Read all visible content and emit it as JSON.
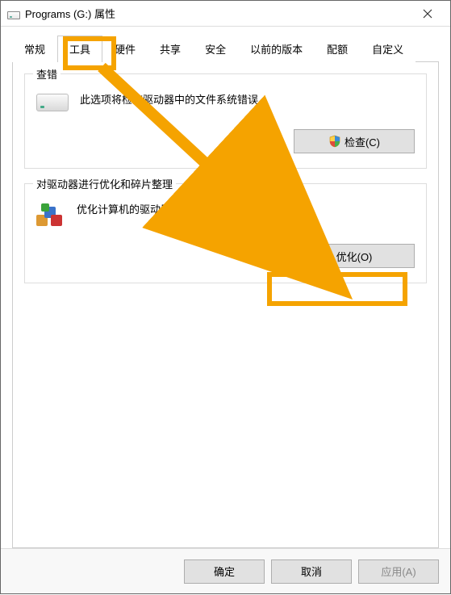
{
  "window": {
    "title": "Programs (G:) 属性"
  },
  "tabs": {
    "items": [
      {
        "label": "常规"
      },
      {
        "label": "工具"
      },
      {
        "label": "硬件"
      },
      {
        "label": "共享"
      },
      {
        "label": "安全"
      },
      {
        "label": "以前的版本"
      },
      {
        "label": "配额"
      },
      {
        "label": "自定义"
      }
    ],
    "active_index": 1
  },
  "groups": {
    "error_check": {
      "title": "查错",
      "description": "此选项将检查驱动器中的文件系统错误。",
      "button_label": "检查(C)"
    },
    "defrag": {
      "title": "对驱动器进行优化和碎片整理",
      "description": "优化计算机的驱动器可以帮助其更高效运行。",
      "button_label": "优化(O)"
    }
  },
  "footer": {
    "ok": "确定",
    "cancel": "取消",
    "apply": "应用(A)"
  },
  "annotations": {
    "highlight_tab": "工具",
    "highlight_button": "优化(O)",
    "arrow_color": "#f5a300"
  }
}
